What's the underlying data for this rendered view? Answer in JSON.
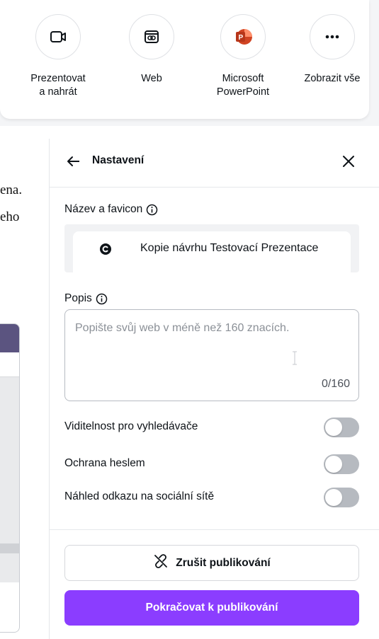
{
  "share_options": [
    {
      "label": "Prezentovat\na nahrát",
      "icon": "video-camera-icon"
    },
    {
      "label": "Web",
      "icon": "web-icon"
    },
    {
      "label": "Microsoft\nPowerPoint",
      "icon": "powerpoint-icon"
    },
    {
      "label": "Zobrazit vše",
      "icon": "more-icon"
    }
  ],
  "background": {
    "line1": "ena.",
    "line2": "eho"
  },
  "settings": {
    "title": "Nastavení",
    "name_label": "Název a favicon",
    "name_value": "Kopie návrhu Testovací Prezentace",
    "desc_label": "Popis",
    "desc_placeholder": "Popište svůj web v méně než 160 znacích.",
    "desc_count": "0/160",
    "toggles": [
      {
        "label": "Viditelnost pro vyhledávače",
        "on": false
      },
      {
        "label": "Ochrana heslem",
        "on": false
      },
      {
        "label": "Náhled odkazu na sociální sítě",
        "on": false
      }
    ],
    "unpublish_label": "Zrušit publikování",
    "publish_label": "Pokračovat k publikování"
  },
  "colors": {
    "accent": "#8b3dff",
    "powerpoint": "#d04423",
    "toggle_off": "#b6bac0"
  }
}
